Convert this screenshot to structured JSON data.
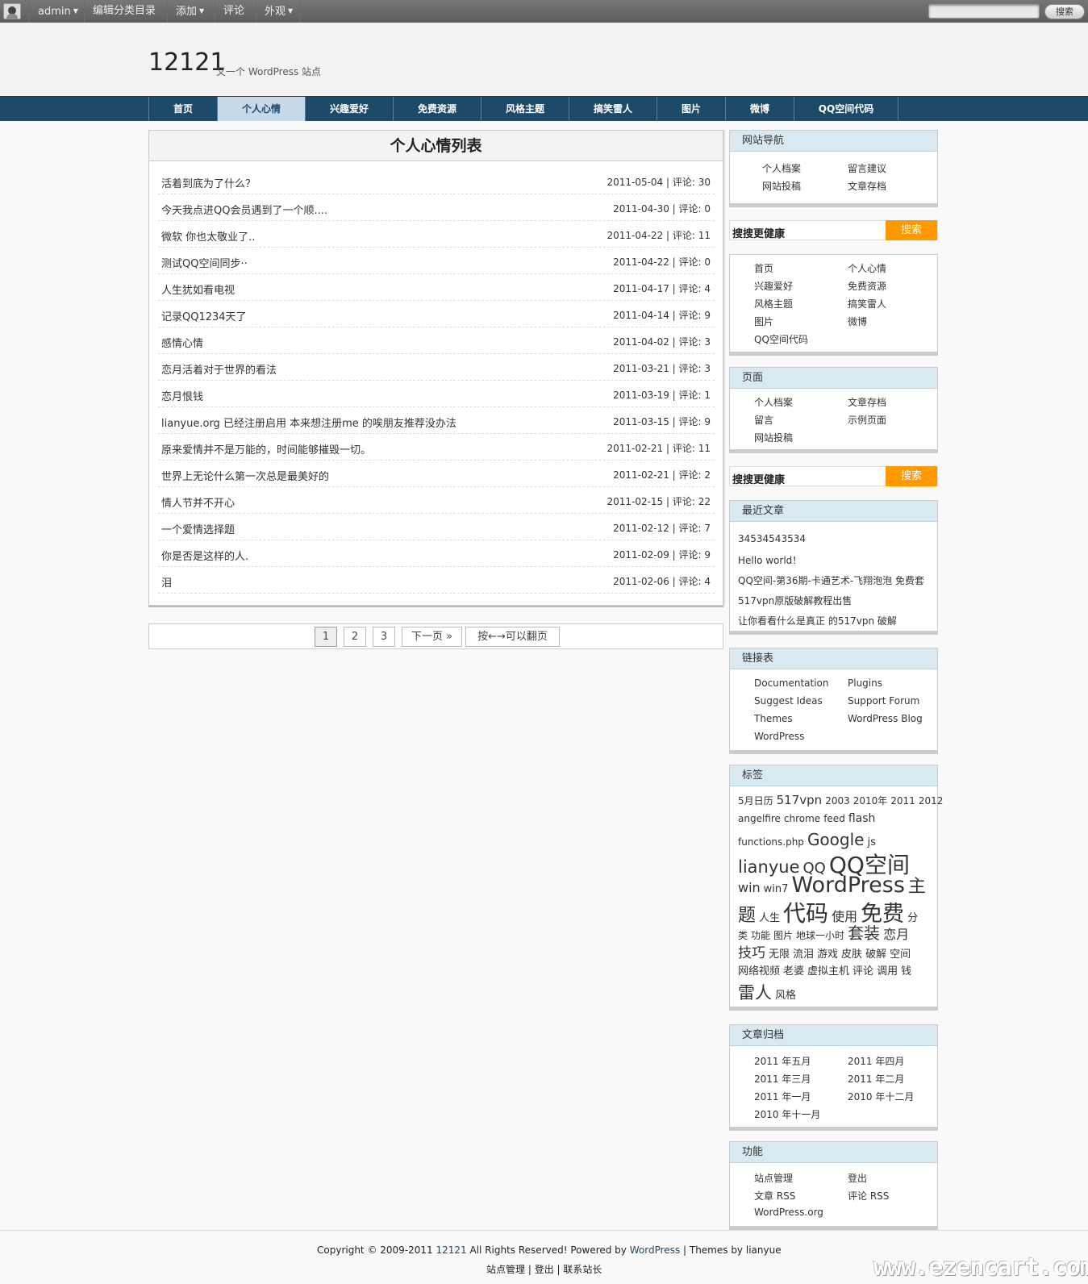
{
  "adminbar": {
    "items": [
      {
        "label": "admin",
        "dropdown": true
      },
      {
        "label": "编辑分类目录",
        "dropdown": false
      },
      {
        "label": "添加",
        "dropdown": true
      },
      {
        "label": "评论",
        "dropdown": false
      },
      {
        "label": "外观",
        "dropdown": true
      }
    ],
    "search_label": "搜索"
  },
  "header": {
    "title": "12121",
    "description": "又一个 WordPress 站点"
  },
  "nav": [
    {
      "label": "首页",
      "active": false
    },
    {
      "label": "个人心情",
      "active": true
    },
    {
      "label": "兴趣爱好",
      "active": false
    },
    {
      "label": "免费资源",
      "active": false
    },
    {
      "label": "风格主题",
      "active": false
    },
    {
      "label": "搞笑雷人",
      "active": false
    },
    {
      "label": "图片",
      "active": false
    },
    {
      "label": "微博",
      "active": false
    },
    {
      "label": "QQ空间代码",
      "active": false
    }
  ],
  "main": {
    "heading": "个人心情列表",
    "posts": [
      {
        "title": "活着到底为了什么？",
        "meta": "2011-05-04 | 评论: 30"
      },
      {
        "title": "今天我点进QQ会员遇到了一个顺....",
        "meta": "2011-04-30 | 评论: 0"
      },
      {
        "title": "微软 你也太敬业了..",
        "meta": "2011-04-22 | 评论: 11"
      },
      {
        "title": "测试QQ空间同步··",
        "meta": "2011-04-22 | 评论: 0"
      },
      {
        "title": "人生犹如看电视",
        "meta": "2011-04-17 | 评论: 4"
      },
      {
        "title": "记录QQ1234天了",
        "meta": "2011-04-14 | 评论: 9"
      },
      {
        "title": "感情心情",
        "meta": "2011-04-02 | 评论: 3"
      },
      {
        "title": "恋月活着对于世界的看法",
        "meta": "2011-03-21 | 评论: 3"
      },
      {
        "title": "恋月恨钱",
        "meta": "2011-03-19 | 评论: 1"
      },
      {
        "title": "lianyue.org 已经注册启用 本来想注册me 的唉朋友推荐没办法",
        "meta": "2011-03-15 | 评论: 9"
      },
      {
        "title": "原来爱情并不是万能的，时间能够摧毁一切。",
        "meta": "2011-02-21 | 评论: 11"
      },
      {
        "title": "世界上无论什么第一次总是最美好的",
        "meta": "2011-02-21 | 评论: 2"
      },
      {
        "title": "情人节并不开心",
        "meta": "2011-02-15 | 评论: 22"
      },
      {
        "title": "一个爱情选择题",
        "meta": "2011-02-12 | 评论: 7"
      },
      {
        "title": "你是否是这样的人.",
        "meta": "2011-02-09 | 评论: 9"
      },
      {
        "title": "泪",
        "meta": "2011-02-06 | 评论: 4"
      }
    ],
    "pagination": {
      "pages": [
        "1",
        "2",
        "3"
      ],
      "current": "1",
      "next": "下一页 »",
      "hint": "按←→可以翻页"
    }
  },
  "sidebar": {
    "site_nav": {
      "title": "网站导航",
      "links": [
        "个人档案",
        "留言建议",
        "网站投稿",
        "文章存档"
      ]
    },
    "search1": {
      "label": "搜搜更健康",
      "button": "搜索"
    },
    "categories": [
      "首页",
      "个人心情",
      "兴趣爱好",
      "免费资源",
      "风格主题",
      "搞笑雷人",
      "图片",
      "微博",
      "QQ空间代码"
    ],
    "pages": {
      "title": "页面",
      "links": [
        "个人档案",
        "文章存档",
        "留言",
        "示例页面",
        "网站投稿"
      ]
    },
    "search2": {
      "label": "搜搜更健康",
      "button": "搜索"
    },
    "recent": {
      "title": "最近文章",
      "links": [
        "34534543534",
        "Hello world！",
        "QQ空间-第36期-卡通艺术-飞翔泡泡 免费套",
        "517vpn原版破解教程出售",
        "让你看看什么是真正 的517vpn 破解"
      ]
    },
    "blogroll": {
      "title": "链接表",
      "links": [
        "Documentation",
        "Plugins",
        "Suggest Ideas",
        "Support Forum",
        "Themes",
        "WordPress Blog",
        "WordPress"
      ]
    },
    "tags": {
      "title": "标签",
      "lines": [
        [
          {
            "t": "5月日历",
            "s": 12
          },
          {
            "t": "517vpn",
            "s": 15
          },
          {
            "t": "2003",
            "s": 12
          },
          {
            "t": "2010年",
            "s": 12
          },
          {
            "t": "2011",
            "s": 12
          },
          {
            "t": "2012",
            "s": 12
          }
        ],
        [
          {
            "t": "angelfire",
            "s": 12
          },
          {
            "t": "chrome",
            "s": 12
          },
          {
            "t": "feed",
            "s": 12
          },
          {
            "t": "flash",
            "s": 14
          }
        ],
        [
          {
            "t": "functions.php",
            "s": 12
          },
          {
            "t": "Google",
            "s": 20
          },
          {
            "t": "js",
            "s": 13
          }
        ],
        [
          {
            "t": "lianyue",
            "s": 21
          },
          {
            "t": "QQ",
            "s": 18
          },
          {
            "t": "QQ空间",
            "s": 28
          }
        ],
        [
          {
            "t": "win",
            "s": 16
          },
          {
            "t": "win7",
            "s": 13
          },
          {
            "t": "WordPress",
            "s": 27
          },
          {
            "t": "主",
            "s": 22
          }
        ],
        [
          {
            "t": "题",
            "s": 22
          },
          {
            "t": "人生",
            "s": 13
          },
          {
            "t": "代码",
            "s": 28
          },
          {
            "t": "使用",
            "s": 16
          },
          {
            "t": "免费",
            "s": 27
          },
          {
            "t": "分",
            "s": 13
          }
        ],
        [
          {
            "t": "类",
            "s": 12
          },
          {
            "t": "功能",
            "s": 12
          },
          {
            "t": "图片",
            "s": 12
          },
          {
            "t": "地球一小时",
            "s": 12
          },
          {
            "t": "套装",
            "s": 20
          },
          {
            "t": "恋月",
            "s": 16
          }
        ],
        [
          {
            "t": "技巧",
            "s": 17
          },
          {
            "t": "无限",
            "s": 13
          },
          {
            "t": "流泪",
            "s": 13
          },
          {
            "t": "游戏",
            "s": 13
          },
          {
            "t": "皮肤",
            "s": 13
          },
          {
            "t": "破解",
            "s": 13
          },
          {
            "t": "空间",
            "s": 13
          }
        ],
        [
          {
            "t": "网络视频",
            "s": 13
          },
          {
            "t": "老婆",
            "s": 13
          },
          {
            "t": "虚拟主机",
            "s": 13
          },
          {
            "t": "评论",
            "s": 13
          },
          {
            "t": "调用",
            "s": 13
          },
          {
            "t": "钱",
            "s": 13
          }
        ],
        [
          {
            "t": "雷人",
            "s": 21
          },
          {
            "t": "风格",
            "s": 13
          }
        ]
      ]
    },
    "archives": {
      "title": "文章归档",
      "links": [
        "2011 年五月",
        "2011 年四月",
        "2011 年三月",
        "2011 年二月",
        "2011 年一月",
        "2010 年十二月",
        "2010 年十一月"
      ]
    },
    "meta": {
      "title": "功能",
      "links": [
        "站点管理",
        "登出",
        "文章 RSS",
        "评论 RSS",
        "WordPress.org"
      ]
    }
  },
  "footer": {
    "copyright_prefix": "Copyright © 2009-2011",
    "site": "12121",
    "rights": "All Rights Reserved! Powered by",
    "wp": "WordPress",
    "themes": "| Themes by",
    "author": "lianyue",
    "links": [
      "站点管理",
      "登出",
      "联系站长"
    ]
  },
  "watermark": "www.ezencart.com"
}
